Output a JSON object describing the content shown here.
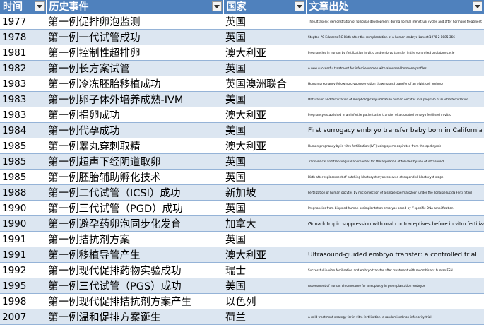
{
  "headers": {
    "year": "时间",
    "event": "历史事件",
    "country": "国家",
    "source": "文章出处"
  },
  "rows": [
    {
      "year": "1977",
      "event": "第一例促排卵泡监测",
      "country": "英国",
      "source": "The ultrasonic demonstration of follicular development during normal menstrual cycles and after hormone treatment",
      "size": "small"
    },
    {
      "year": "1978",
      "event": "第一例一代试管成功",
      "country": "英国",
      "source": "Steptoe PC Edwards RG Birth after the reimplantation of a human embryo Lancet 1978 2 8085 366",
      "size": "small"
    },
    {
      "year": "1981",
      "event": "第一例控制性超排卵",
      "country": "澳大利亚",
      "source": "Pregnancies in human by fertilization in vitro and embryo transfer in the controlled ovulatory cycle",
      "size": "small"
    },
    {
      "year": "1982",
      "event": "第一例长方案试管",
      "country": "英国",
      "source": "A new successful treatment for infertile women with abnormal hormone profiles",
      "size": "small"
    },
    {
      "year": "1983",
      "event": "第一例冷冻胚胎移植成功",
      "country": "英国澳洲联合",
      "source": "Human pregnancy following cryopreservation thawing and transfer of an eight-cell embryo",
      "size": "small"
    },
    {
      "year": "1983",
      "event": "第一例卵子体外培养成熟-IVM",
      "country": "美国",
      "source": "Maturation and fertilization of morphologically immature human oocytes in a program of in vitro fertilization",
      "size": "small"
    },
    {
      "year": "1983",
      "event": "第一例捐卵成功",
      "country": "澳大利亚",
      "source": "Pregnancy established in an infertile patient after transfer of a donated embryo fertilised in vitro",
      "size": "small"
    },
    {
      "year": "1984",
      "event": "第一例代孕成功",
      "country": "美国",
      "source": "First surrogacy embryo transfer baby born in California",
      "size": "big"
    },
    {
      "year": "1985",
      "event": "第一例睾丸穿刺取精",
      "country": "澳大利亚",
      "source": "Human pregnancy by in vitro fertilization (IVF) using sperm aspirated from the epididymis",
      "size": "small"
    },
    {
      "year": "1985",
      "event": "第一例超声下经阴道取卵",
      "country": "英国",
      "source": "Transvesical and transvaginal approaches for the aspiration of follicles by use of ultrasound",
      "size": "small"
    },
    {
      "year": "1985",
      "event": "第一例胚胎辅助孵化技术",
      "country": "英国",
      "source": "Birth after replacement of hatching blastocyst cryopreserved at expanded blastocyst stage",
      "size": "small"
    },
    {
      "year": "1988",
      "event": "第一例二代试管（ICSI）成功",
      "country": "新加坡",
      "source": "Fertilization of human oocytes by microinjection of a single spermatozoon under the zona pellucida Fertil Steril",
      "size": "small"
    },
    {
      "year": "1990",
      "event": "第一例三代试管（PGD）成功",
      "country": "英国",
      "source": "Pregnancies from biopsied human preimplantation embryos sexed by Y-specific DNA amplification",
      "size": "small"
    },
    {
      "year": "1990",
      "event": "第一例避孕药卵泡同步化发育",
      "country": "加拿大",
      "source": "Gonadotropin suppression with oral contraceptives before in vitro fertilization",
      "size": "mid"
    },
    {
      "year": "1991",
      "event": "第一例拮抗剂方案",
      "country": "英国",
      "source": "",
      "size": "small"
    },
    {
      "year": "1991",
      "event": "第一例移植导管产生",
      "country": "澳大利亚",
      "source": "Ultrasound-guided embryo transfer: a controlled trial",
      "size": "big"
    },
    {
      "year": "1992",
      "event": "第一例现代促排药物实验成功",
      "country": "瑞士",
      "source": "Successful in-vitro fertilisation and embryo transfer after treatment with recombinant human FSH",
      "size": "small"
    },
    {
      "year": "1995",
      "event": "第一例三代试管（PGS）成功",
      "country": "美国",
      "source": "Assessment of human chromosome for aneuploidy in preimplantation embryos",
      "size": "small"
    },
    {
      "year": "1998",
      "event": "第一例现代促排拮抗剂方案产生",
      "country": "以色列",
      "source": "",
      "size": "small"
    },
    {
      "year": "2007",
      "event": "第一例温和促排方案诞生",
      "country": "荷兰",
      "source": "A mild treatment strategy for in-vitro fertilisation: a randomised non-inferiority trial",
      "size": "small"
    }
  ],
  "icons": {
    "filter": "filter-dropdown-icon"
  },
  "colors": {
    "header_bg": "#4f81bd",
    "band_bg": "#dce6f1",
    "row_border": "#95b3d7"
  }
}
